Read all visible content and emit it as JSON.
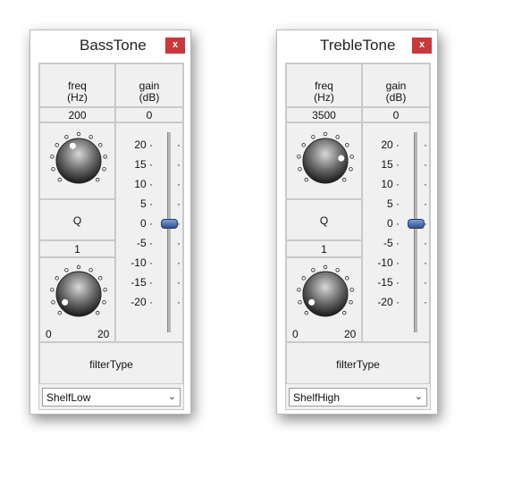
{
  "windows": [
    {
      "title": "BassTone",
      "close_label": "x",
      "freq_label_1": "freq",
      "freq_label_2": "(Hz)",
      "freq_value": "200",
      "gain_label_1": "gain",
      "gain_label_2": "(dB)",
      "gain_value": "0",
      "q_label": "Q",
      "q_value": "1",
      "q_range_min": "0",
      "q_range_max": "20",
      "filter_label": "filterType",
      "filter_selected": "ShelfLow",
      "freq_knob_level": 0.42,
      "q_knob_level": 0.05
    },
    {
      "title": "TrebleTone",
      "close_label": "x",
      "freq_label_1": "freq",
      "freq_label_2": "(Hz)",
      "freq_value": "3500",
      "gain_label_1": "gain",
      "gain_label_2": "(dB)",
      "gain_value": "0",
      "q_label": "Q",
      "q_value": "1",
      "q_range_min": "0",
      "q_range_max": "20",
      "filter_label": "filterType",
      "filter_selected": "ShelfHigh",
      "freq_knob_level": 0.8,
      "q_knob_level": 0.05
    }
  ],
  "gain_ticks": [
    "20",
    "15",
    "10",
    "5",
    "0",
    "-5",
    "-10",
    "-15",
    "-20"
  ],
  "gain_slider_value": 0,
  "icons": {
    "close": "close-icon",
    "dropdown": "chevron-down-icon"
  },
  "colors": {
    "close_button": "#c9383a",
    "slider_thumb": "#3a5fa8",
    "panel_bg": "#f0f0f0"
  }
}
